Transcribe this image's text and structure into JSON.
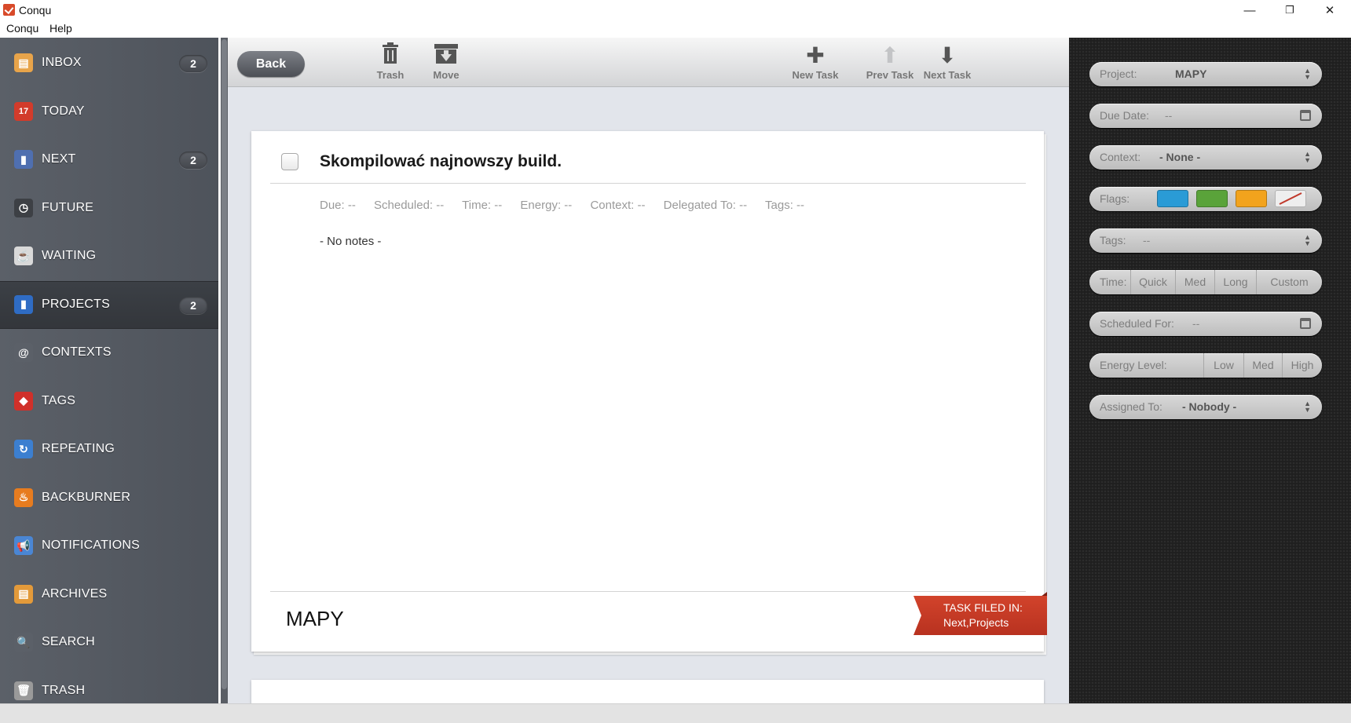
{
  "window": {
    "title": "Conqu",
    "minimize": "—",
    "restore": "❐",
    "close": "✕"
  },
  "menu": {
    "items": [
      "Conqu",
      "Help"
    ]
  },
  "sidebar": {
    "items": [
      {
        "label": "INBOX",
        "badge": "2",
        "icon": "inbox-icon",
        "color": "#e8a44a",
        "glyph": "▤"
      },
      {
        "label": "TODAY",
        "badge": "",
        "icon": "calendar-icon",
        "color": "#d23b2b",
        "glyph": "17"
      },
      {
        "label": "NEXT",
        "badge": "2",
        "icon": "next-folder-icon",
        "color": "#4f6fb0",
        "glyph": "▮"
      },
      {
        "label": "FUTURE",
        "badge": "",
        "icon": "clock-icon",
        "color": "#3d4045",
        "glyph": "◷"
      },
      {
        "label": "WAITING",
        "badge": "",
        "icon": "coffee-cup-icon",
        "color": "#d9d9d9",
        "glyph": "☕"
      },
      {
        "label": "PROJECTS",
        "badge": "2",
        "icon": "projects-icon",
        "color": "#2f6cc4",
        "glyph": "▮"
      },
      {
        "label": "CONTEXTS",
        "badge": "",
        "icon": "at-sign-icon",
        "color": "#5b6068",
        "glyph": "@"
      },
      {
        "label": "TAGS",
        "badge": "",
        "icon": "tag-icon",
        "color": "#d0302a",
        "glyph": "◆"
      },
      {
        "label": "REPEATING",
        "badge": "",
        "icon": "repeat-icon",
        "color": "#3c7fd0",
        "glyph": "↻"
      },
      {
        "label": "BACKBURNER",
        "badge": "",
        "icon": "flame-icon",
        "color": "#e77c1f",
        "glyph": "♨"
      },
      {
        "label": "NOTIFICATIONS",
        "badge": "",
        "icon": "megaphone-icon",
        "color": "#4a86d4",
        "glyph": "📢"
      },
      {
        "label": "ARCHIVES",
        "badge": "",
        "icon": "archive-box-icon",
        "color": "#e39a3a",
        "glyph": "▤"
      },
      {
        "label": "SEARCH",
        "badge": "",
        "icon": "magnifier-icon",
        "color": "#5b6068",
        "glyph": "🔍"
      },
      {
        "label": "TRASH",
        "badge": "",
        "icon": "trash-can-icon",
        "color": "#9a9a9a",
        "glyph": "🗑"
      }
    ],
    "active": "PROJECTS"
  },
  "toolbar": {
    "back": "Back",
    "trash": "Trash",
    "move": "Move",
    "new_task": "New Task",
    "prev_task": "Prev Task",
    "next_task": "Next Task"
  },
  "task": {
    "title": "Skompilować najnowszy build.",
    "meta": {
      "due": "Due: --",
      "scheduled": "Scheduled: --",
      "time": "Time: --",
      "energy": "Energy: --",
      "context": "Context: --",
      "delegated": "Delegated To: --",
      "tags": "Tags: --"
    },
    "notes": "- No notes -",
    "project": "MAPY",
    "filed_label": "TASK FILED IN:",
    "filed_value": "Next,Projects"
  },
  "panel": {
    "project": {
      "label": "Project:",
      "value": "MAPY"
    },
    "due_date": {
      "label": "Due Date:",
      "value": "--"
    },
    "context": {
      "label": "Context:",
      "value": "- None -"
    },
    "flags": {
      "label": "Flags:",
      "colors": [
        "#2a9bd6",
        "#5aa33a",
        "#f2a31d"
      ]
    },
    "tags": {
      "label": "Tags:",
      "value": "--"
    },
    "time": {
      "label": "Time:",
      "options": [
        "Quick",
        "Med",
        "Long",
        "Custom"
      ]
    },
    "scheduled_for": {
      "label": "Scheduled For:",
      "value": "--"
    },
    "energy": {
      "label": "Energy Level:",
      "options": [
        "Low",
        "Med",
        "High"
      ]
    },
    "assigned_to": {
      "label": "Assigned To:",
      "value": "- Nobody -"
    }
  }
}
